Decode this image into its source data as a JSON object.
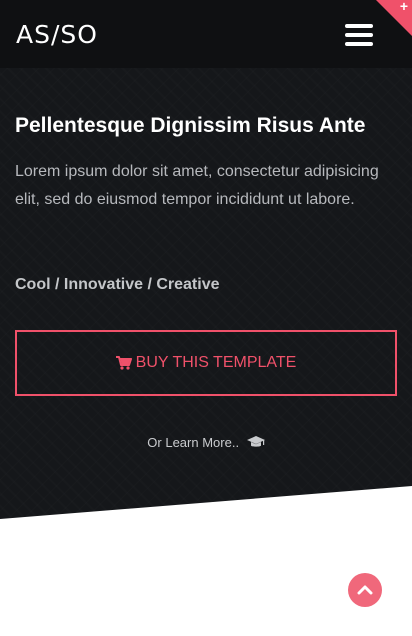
{
  "header": {
    "logo_text": "AS/SO",
    "menu_icon": "hamburger-menu-icon",
    "corner_icon": "plus-icon",
    "corner_glyph": "+"
  },
  "hero": {
    "headline": "Pellentesque Dignissim Risus Ante",
    "lead": "Lorem ipsum dolor sit amet, consectetur adipisicing elit, sed do eiusmod tempor incididunt ut labore.",
    "tagline": "Cool / Innovative / Creative",
    "buy_button": {
      "label": "BUY THIS TEMPLATE",
      "icon": "shopping-cart-icon"
    },
    "learn_more": {
      "label": "Or Learn More..",
      "icon": "graduation-cap-icon"
    }
  },
  "scroll_top": {
    "icon": "chevron-up-icon"
  },
  "colors": {
    "accent": "#f0516a",
    "hero_background": "#15171a",
    "navbar_background": "#0f1012",
    "page_background": "#ffffff"
  }
}
